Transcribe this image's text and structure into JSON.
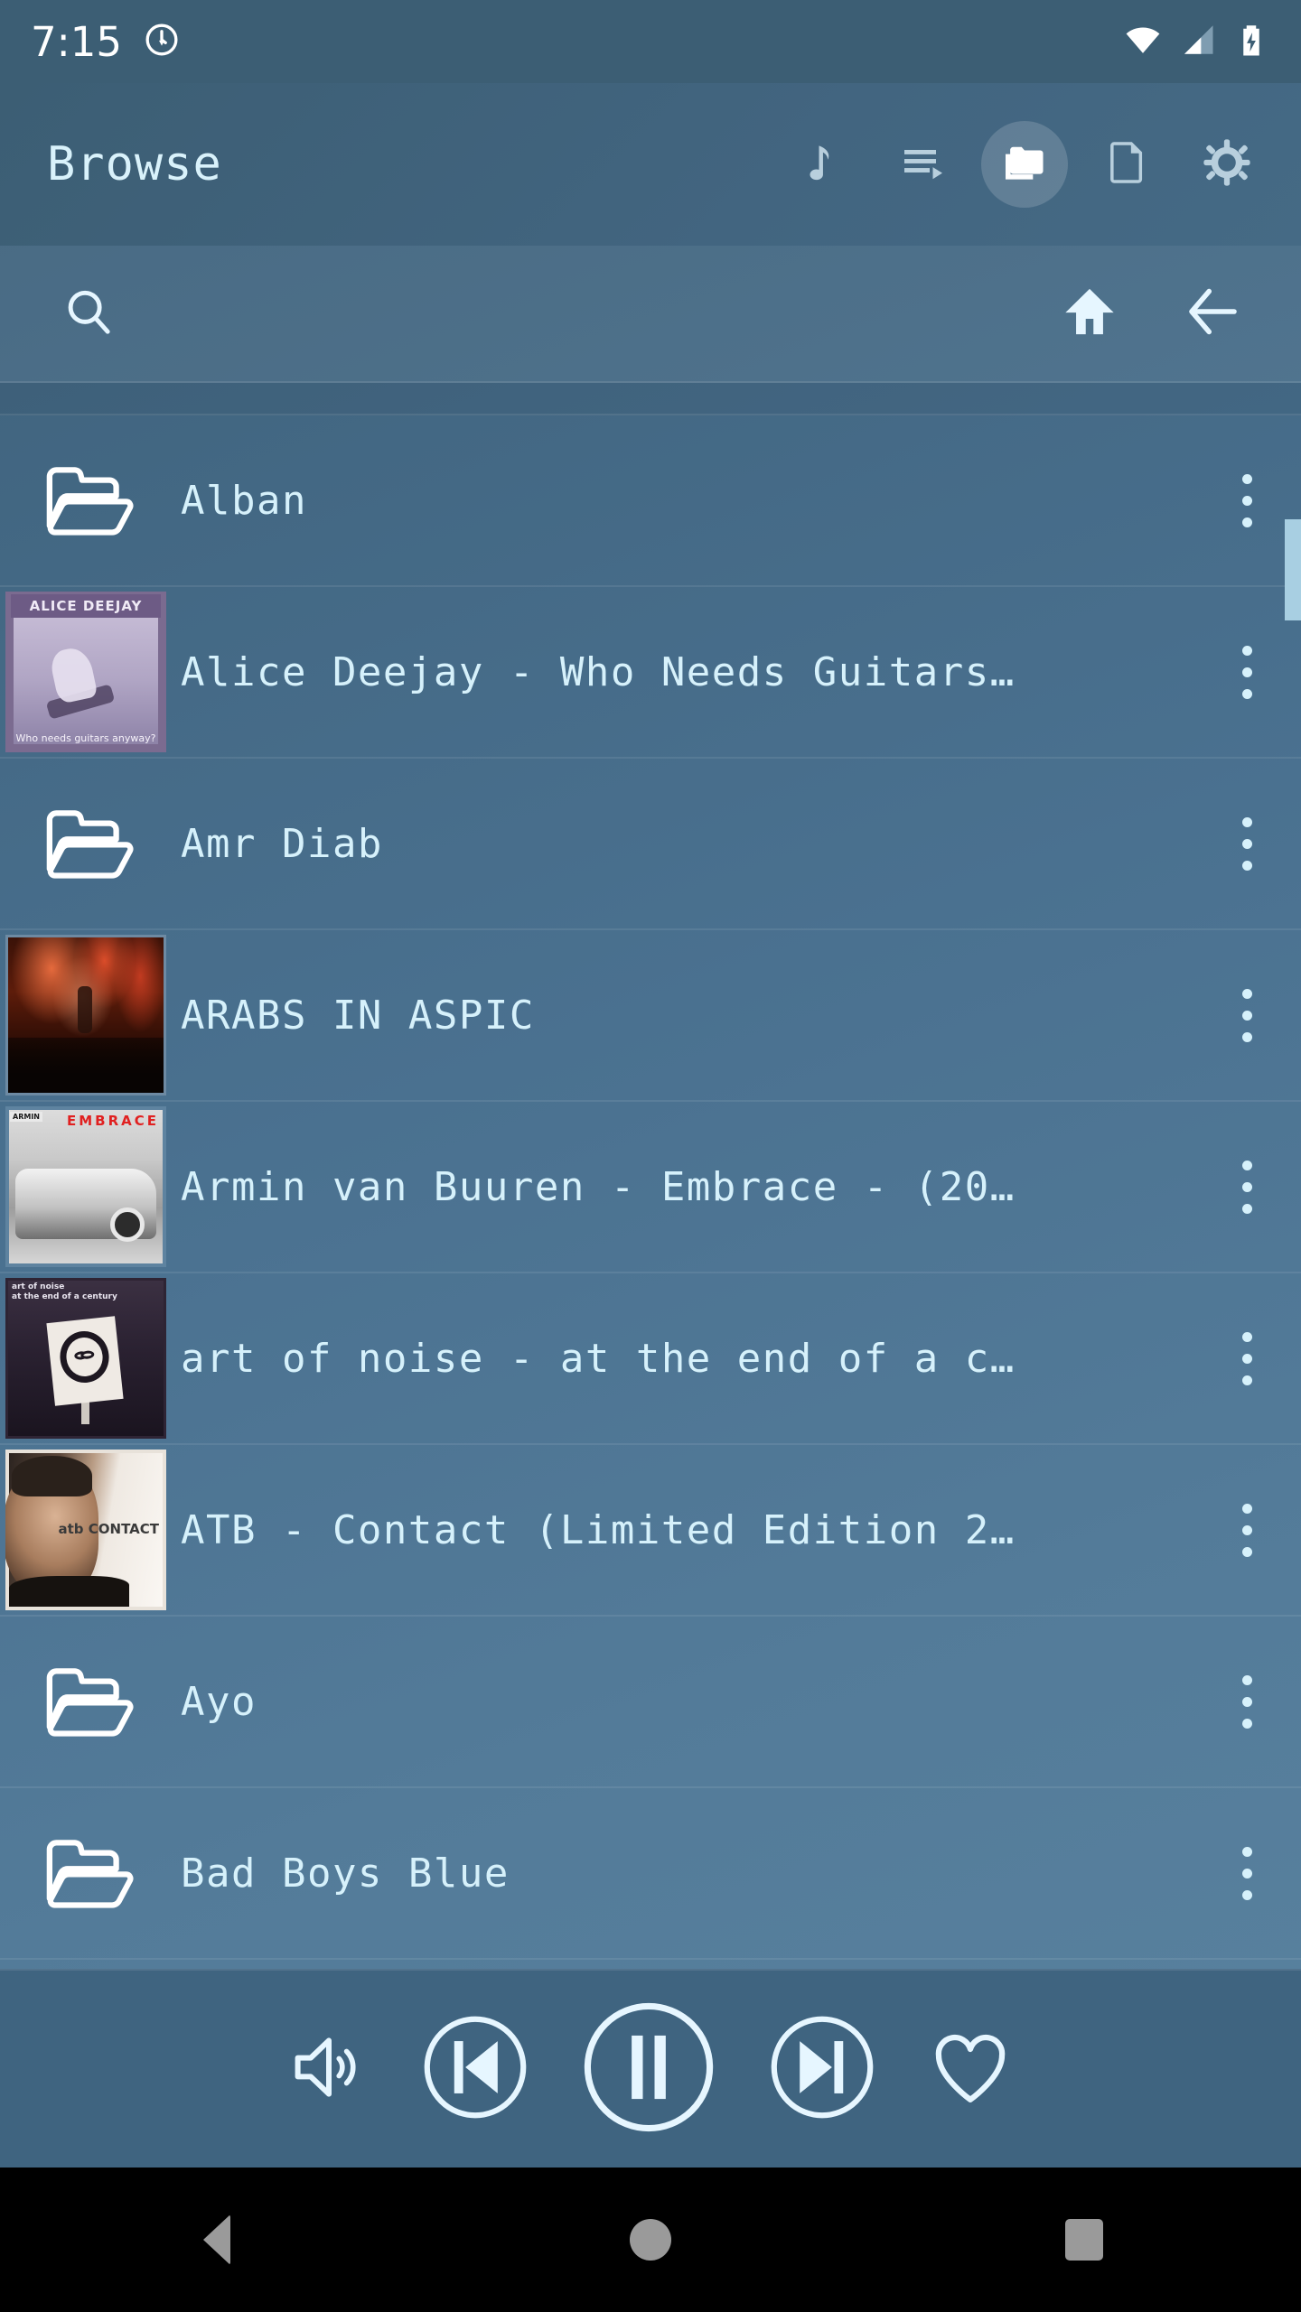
{
  "status_bar": {
    "time": "7:15",
    "icons": [
      "alarm-icon",
      "wifi-icon",
      "cellular-signal-icon",
      "battery-charging-icon"
    ]
  },
  "app_bar": {
    "title": "Browse",
    "actions": [
      {
        "name": "music-note-icon",
        "label": "Tracks",
        "active": false
      },
      {
        "name": "playlist-icon",
        "label": "Playlist",
        "active": false
      },
      {
        "name": "folders-icon",
        "label": "Folders",
        "active": true
      },
      {
        "name": "file-icon",
        "label": "Files",
        "active": false
      },
      {
        "name": "gear-icon",
        "label": "Settings",
        "active": false
      }
    ]
  },
  "search_bar": {
    "search_label": "Search",
    "home_label": "Home",
    "back_label": "Up one level"
  },
  "list": {
    "scroll_position_percent": 7,
    "rows": [
      {
        "title": "Alban",
        "type": "folder",
        "art": "none"
      },
      {
        "title": "Alice Deejay - Who Needs Guitars…",
        "type": "album",
        "art": "alice"
      },
      {
        "title": "Amr Diab",
        "type": "folder",
        "art": "none"
      },
      {
        "title": "ARABS IN ASPIC",
        "type": "album",
        "art": "arabs"
      },
      {
        "title": "Armin van Buuren - Embrace - (20…",
        "type": "album",
        "art": "armin"
      },
      {
        "title": "art of noise - at the end of a c…",
        "type": "album",
        "art": "aon"
      },
      {
        "title": "ATB - Contact (Limited Edition 2…",
        "type": "album",
        "art": "atb"
      },
      {
        "title": "Ayo",
        "type": "folder",
        "art": "none"
      },
      {
        "title": "Bad Boys Blue",
        "type": "folder",
        "art": "none"
      }
    ],
    "row_menu_label": "More options"
  },
  "album_art_text": {
    "alice_band": "ALICE DEEJAY",
    "alice_caption": "Who needs guitars anyway?",
    "armin_title": "EMBRACE",
    "armin_artist": "ARMIN",
    "aon_title": "art of noise\nat the end of a century",
    "atb_title": "atb CONTACT"
  },
  "player": {
    "buttons": [
      {
        "name": "volume-icon",
        "label": "Volume"
      },
      {
        "name": "previous-icon",
        "label": "Previous"
      },
      {
        "name": "pause-icon",
        "label": "Pause"
      },
      {
        "name": "next-icon",
        "label": "Next"
      },
      {
        "name": "favorite-heart-icon",
        "label": "Favorite"
      }
    ],
    "state": "playing"
  },
  "nav_bar": {
    "buttons": [
      {
        "name": "android-back-icon",
        "label": "Back"
      },
      {
        "name": "android-home-icon",
        "label": "Home"
      },
      {
        "name": "android-recents-icon",
        "label": "Recents"
      }
    ]
  },
  "colors": {
    "app_bar": "#3c5e74",
    "background_top": "#3d6079",
    "background_bottom": "#5a83a0",
    "text": "#d6f1fb",
    "accent": "#a8cfe2",
    "nav_bar": "#000000",
    "nav_icon": "#9a9a9a"
  }
}
